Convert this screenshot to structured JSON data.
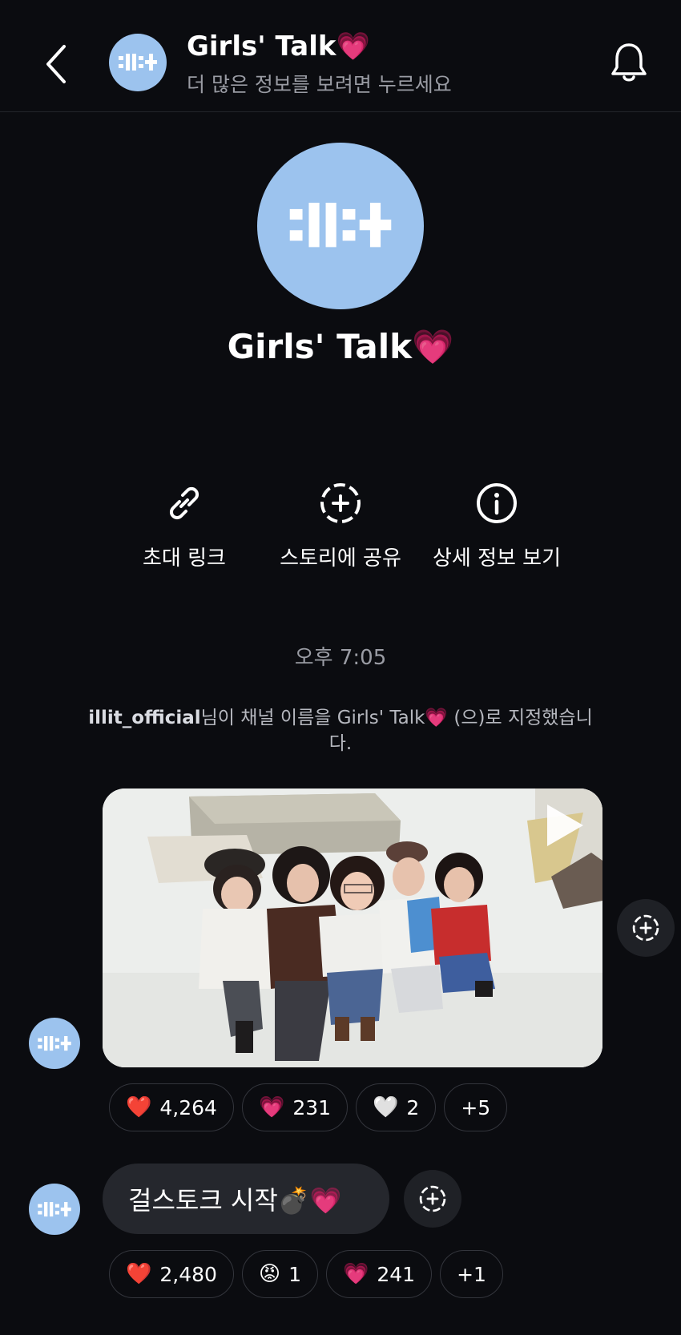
{
  "header": {
    "title": "Girls' Talk💗",
    "subtitle": "더 많은 정보를 보려면 누르세요"
  },
  "channel": {
    "name": "Girls' Talk💗",
    "logo_text": ":ll:+"
  },
  "actions": [
    {
      "label": "초대 링크",
      "icon": "link-icon"
    },
    {
      "label": "스토리에 공유",
      "icon": "add-story-icon"
    },
    {
      "label": "상세 정보 보기",
      "icon": "info-icon"
    }
  ],
  "timestamp": "오후 7:05",
  "system_message": {
    "user": "illit_official",
    "text": "님이 채널 이름을 Girls' Talk💗 (으)로 지정했습니다."
  },
  "messages": [
    {
      "type": "video",
      "reactions": [
        {
          "emoji": "❤️",
          "count": "4,264"
        },
        {
          "emoji": "💗",
          "count": "231"
        },
        {
          "emoji": "🤍",
          "count": "2"
        },
        {
          "emoji": "",
          "count": "+5"
        }
      ]
    },
    {
      "type": "text",
      "text": "걸스토크 시작💣💗",
      "reactions": [
        {
          "emoji": "❤️",
          "count": "2,480"
        },
        {
          "emoji": "😡",
          "count": "1"
        },
        {
          "emoji": "💗",
          "count": "241"
        },
        {
          "emoji": "",
          "count": "+1"
        }
      ]
    }
  ],
  "colors": {
    "background": "#0b0c10",
    "avatar": "#9cc3ee",
    "bubble": "#25272d",
    "muted_text": "#9a9ca4"
  }
}
